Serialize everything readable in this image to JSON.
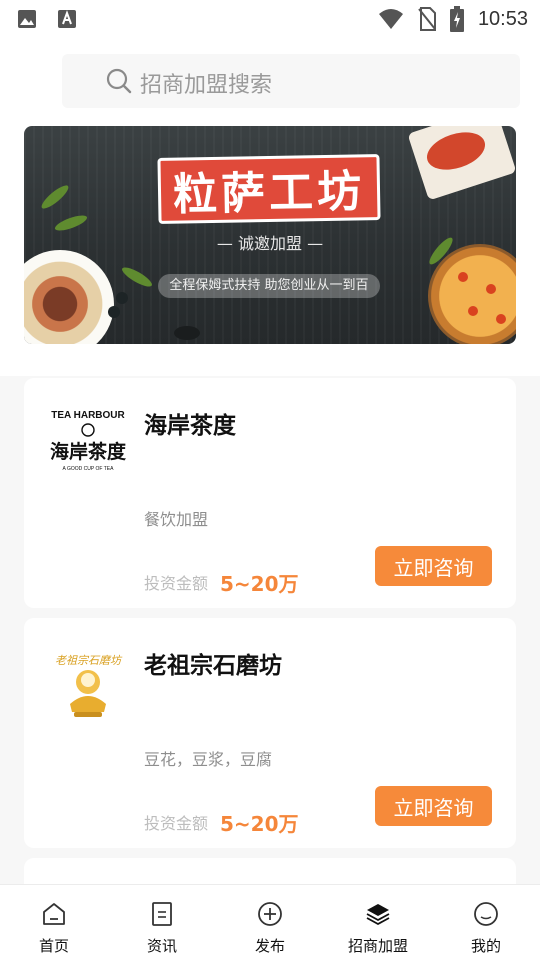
{
  "status_bar": {
    "time": "10:53",
    "left_icons": [
      "image-icon",
      "font-app-icon"
    ],
    "right_icons": [
      "wifi-icon",
      "no-sim-icon",
      "battery-charging-icon"
    ]
  },
  "search": {
    "placeholder": "招商加盟搜索"
  },
  "banner": {
    "title": "粒萨工坊",
    "subtitle": "— 诚邀加盟 —",
    "tagline": "全程保姆式扶持 助您创业从一到百"
  },
  "listings": [
    {
      "name": "海岸茶度",
      "category": "餐饮加盟",
      "invest_label": "投资金额",
      "invest_value": "5~20万",
      "button_label": "立即咨询",
      "logo": {
        "line1": "TEA HARBOUR",
        "line2": "海岸茶度",
        "line3": "A GOOD CUP OF TEA"
      }
    },
    {
      "name": "老祖宗石磨坊",
      "category": "豆花，豆浆，豆腐",
      "invest_label": "投资金额",
      "invest_value": "5~20万",
      "button_label": "立即咨询",
      "logo": {
        "line1": "老祖宗石磨坊"
      }
    }
  ],
  "tab_bar": {
    "tabs": [
      {
        "label": "首页",
        "icon": "home-icon"
      },
      {
        "label": "资讯",
        "icon": "news-icon"
      },
      {
        "label": "发布",
        "icon": "publish-plus-icon"
      },
      {
        "label": "招商加盟",
        "icon": "layers-icon"
      },
      {
        "label": "我的",
        "icon": "profile-smile-icon"
      }
    ],
    "active_index": 3
  },
  "colors": {
    "accent": "#f68a3a",
    "invest_value": "#f5863a",
    "page_bg": "#f7f7f7"
  }
}
